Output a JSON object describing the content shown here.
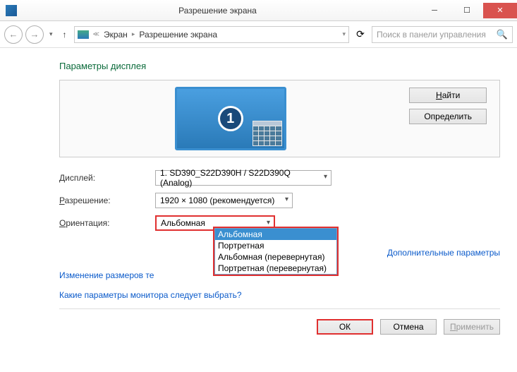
{
  "window": {
    "title": "Разрешение экрана"
  },
  "breadcrumb": {
    "root": "Экран",
    "current": "Разрешение экрана"
  },
  "search": {
    "placeholder": "Поиск в панели управления"
  },
  "heading": "Параметры дисплея",
  "panel_buttons": {
    "find": "Найти",
    "detect": "Определить"
  },
  "monitor_number": "1",
  "labels": {
    "display": "Дисплей:",
    "resolution": "Разрешение:",
    "orientation": "Ориентация:"
  },
  "display_select": "1. SD390_S22D390H / S22D390Q (Analog)",
  "resolution_select": "1920 × 1080 (рекомендуется)",
  "orientation_select": "Альбомная",
  "orientation_options": [
    "Альбомная",
    "Портретная",
    "Альбомная (перевернутая)",
    "Портретная (перевернутая)"
  ],
  "links": {
    "advanced": "Дополнительные параметры",
    "text_size": "Изменение размеров те",
    "which_monitor": "Какие параметры монитора следует выбрать?"
  },
  "footer": {
    "ok": "ОК",
    "cancel": "Отмена",
    "apply": "Применить"
  }
}
